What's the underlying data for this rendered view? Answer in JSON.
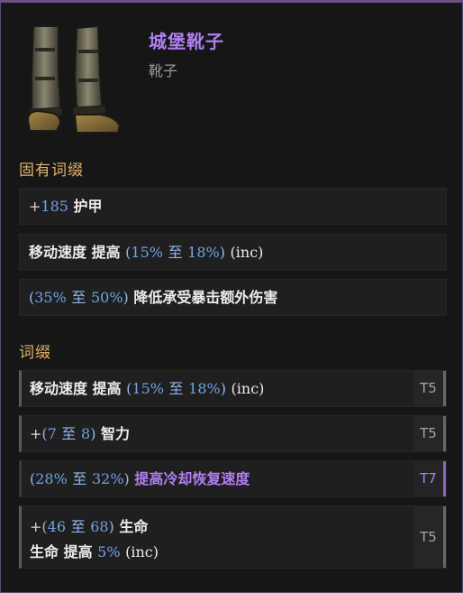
{
  "item": {
    "name": "城堡靴子",
    "type": "靴子",
    "icon": "boots-icon"
  },
  "implicit": {
    "title": "固有词缀",
    "rows": [
      {
        "plus": "+",
        "value": "185",
        "label": "护甲"
      },
      {
        "label": "移动速度 提高",
        "paren_open": "(",
        "min": "15%",
        "to": "至",
        "max": "18%",
        "paren_close": ")",
        "inc": "(inc)"
      },
      {
        "paren_open": "(",
        "min": "35%",
        "to": "至",
        "max": "50%",
        "paren_close": ")",
        "label": "降低承受暴击额外伤害"
      }
    ]
  },
  "affixes": {
    "title": "词缀",
    "rows": [
      {
        "label": "移动速度 提高",
        "paren_open": "(",
        "min": "15%",
        "to": "至",
        "max": "18%",
        "paren_close": ")",
        "inc": "(inc)",
        "tier": "T5"
      },
      {
        "plus": "+",
        "paren_open": "(",
        "min": "7",
        "to": "至",
        "max": "8",
        "paren_close": ")",
        "label": "智力",
        "tier": "T5"
      },
      {
        "paren_open": "(",
        "min": "28%",
        "to": "至",
        "max": "32%",
        "paren_close": ")",
        "label": "提高冷却恢复速度",
        "tier": "T7"
      },
      {
        "plus": "+",
        "paren_open": "(",
        "min": "46",
        "to": "至",
        "max": "68",
        "paren_close": ")",
        "label": "生命",
        "line2_label": "生命 提高",
        "line2_value": "5%",
        "line2_inc": "(inc)",
        "tier": "T5"
      }
    ]
  },
  "colors": {
    "unique_name": "#b07ff0",
    "section_title": "#e3b26a",
    "number": "#6fa3e6",
    "tier_t7": "#b07ff0"
  }
}
